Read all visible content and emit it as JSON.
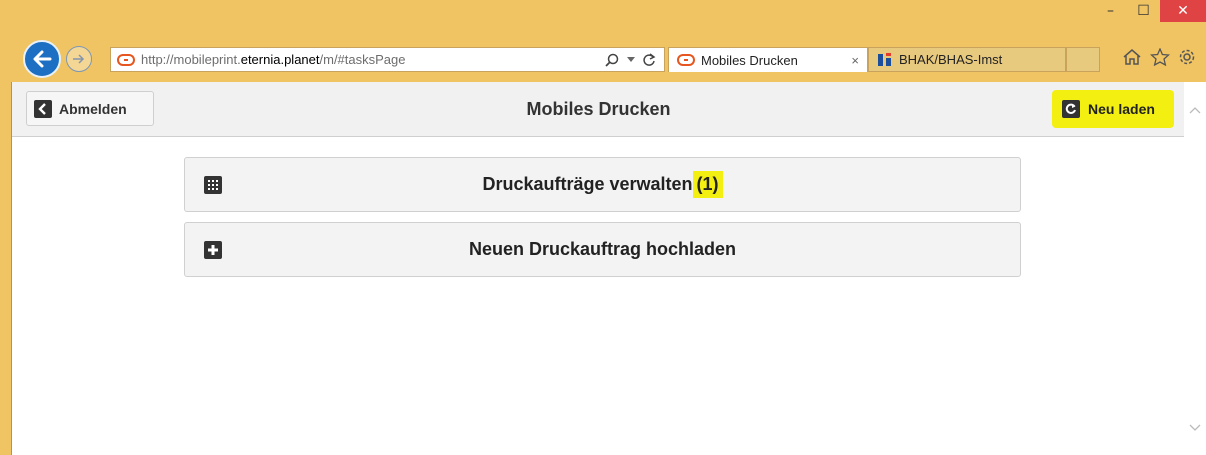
{
  "browser": {
    "url_prefix": "http://mobileprint.",
    "url_domain": "eternia.planet",
    "url_path": "/m/#tasksPage",
    "tabs": [
      {
        "label": "Mobiles Drucken",
        "close": "×"
      },
      {
        "label": "BHAK/BHAS-Imst"
      }
    ],
    "window_controls": {
      "minimize": "–",
      "maximize": "☐",
      "close": "✕"
    }
  },
  "header": {
    "logout_label": "Abmelden",
    "title": "Mobiles Drucken",
    "reload_label": "Neu laden"
  },
  "main": {
    "manage_label": "Druckaufträge verwalten",
    "manage_count": "(1)",
    "upload_label": "Neuen Druckauftrag hochladen"
  },
  "colors": {
    "highlight": "#f2ef11",
    "browser_frame": "#f0c463",
    "back_button": "#1c6fc2"
  },
  "icons": [
    "back-arrow-icon",
    "forward-arrow-icon",
    "site-icon",
    "search-icon",
    "refresh-icon",
    "home-icon",
    "star-icon",
    "gear-icon",
    "chevron-left-icon",
    "reload-icon",
    "grid-icon",
    "plus-icon",
    "chevron-up-icon",
    "chevron-down-icon"
  ]
}
